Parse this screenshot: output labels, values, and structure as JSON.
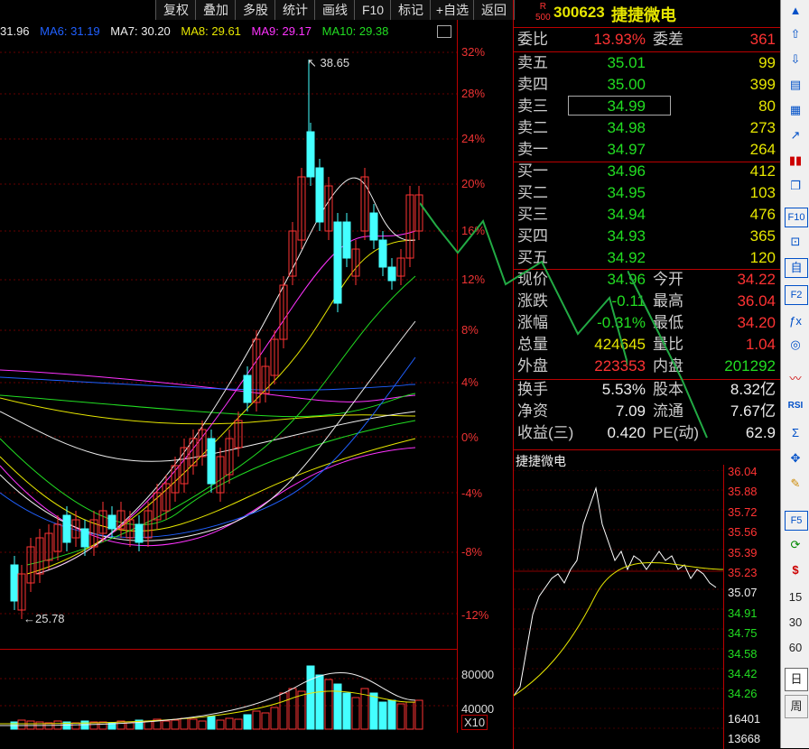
{
  "toolbar": {
    "buttons": [
      "复权",
      "叠加",
      "多股",
      "统计",
      "画线",
      "F10",
      "标记",
      "+自选",
      "返回"
    ]
  },
  "ma": [
    {
      "label": "31.96",
      "color": "#eeeeee"
    },
    {
      "label": "MA6: 31.19",
      "color": "#2060ff"
    },
    {
      "label": "MA7: 30.20",
      "color": "#eeeeee"
    },
    {
      "label": "MA8: 29.61",
      "color": "#e6e600"
    },
    {
      "label": "MA9: 29.17",
      "color": "#ff33ff"
    },
    {
      "label": "MA10: 29.38",
      "color": "#22dd22"
    }
  ],
  "kline": {
    "high_label": "38.65",
    "low_label": "25.78",
    "pct_axis": [
      "32%",
      "28%",
      "24%",
      "20%",
      "16%",
      "12%",
      "8%",
      "4%",
      "0%",
      "-4%",
      "-8%",
      "-12%"
    ]
  },
  "volume": {
    "labels": [
      "80000",
      "40000"
    ],
    "unit": "X10"
  },
  "quote": {
    "badge_top": "R",
    "badge_bottom": "500",
    "code": "300623",
    "name": "捷捷微电",
    "weibi": {
      "label": "委比",
      "value": "13.93%",
      "label2": "委差",
      "value2": "361"
    },
    "sell": [
      {
        "label": "卖五",
        "price": "35.01",
        "vol": "99"
      },
      {
        "label": "卖四",
        "price": "35.00",
        "vol": "399"
      },
      {
        "label": "卖三",
        "price": "34.99",
        "vol": "80"
      },
      {
        "label": "卖二",
        "price": "34.98",
        "vol": "273"
      },
      {
        "label": "卖一",
        "price": "34.97",
        "vol": "264"
      }
    ],
    "buy": [
      {
        "label": "买一",
        "price": "34.96",
        "vol": "412"
      },
      {
        "label": "买二",
        "price": "34.95",
        "vol": "103"
      },
      {
        "label": "买三",
        "price": "34.94",
        "vol": "476"
      },
      {
        "label": "买四",
        "price": "34.93",
        "vol": "365"
      },
      {
        "label": "买五",
        "price": "34.92",
        "vol": "120"
      }
    ],
    "stats": [
      {
        "l1": "现价",
        "v1": "34.96",
        "l2": "今开",
        "v2": "34.22"
      },
      {
        "l1": "涨跌",
        "v1": "-0.11",
        "l2": "最高",
        "v2": "36.04"
      },
      {
        "l1": "涨幅",
        "v1": "-0.31%",
        "l2": "最低",
        "v2": "34.20"
      },
      {
        "l1": "总量",
        "v1": "424645",
        "l2": "量比",
        "v2": "1.04"
      },
      {
        "l1": "外盘",
        "v1": "223353",
        "l2": "内盘",
        "v2": "201292"
      }
    ],
    "fund": [
      {
        "l1": "换手",
        "v1": "5.53%",
        "l2": "股本",
        "v2": "8.32亿"
      },
      {
        "l1": "净资",
        "v1": "7.09",
        "l2": "流通",
        "v2": "7.67亿"
      },
      {
        "l1": "收益(三)",
        "v1": "0.420",
        "l2": "PE(动)",
        "v2": "62.9"
      }
    ]
  },
  "intraday": {
    "title": "捷捷微电",
    "price_axis": [
      "36.04",
      "35.88",
      "35.72",
      "35.56",
      "35.39",
      "35.23",
      "35.07",
      "34.91",
      "34.75",
      "34.58",
      "34.42",
      "34.26"
    ],
    "vol_axis": [
      "16401",
      "13668"
    ]
  },
  "right_tools": {
    "numbers": [
      "15",
      "30",
      "60"
    ],
    "day": "日",
    "week": "周"
  }
}
